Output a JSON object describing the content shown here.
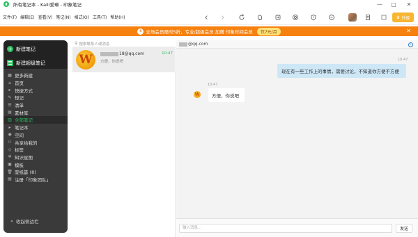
{
  "titlebar": {
    "title": "所有笔记本 - Kaili爱琳 - 印象笔记",
    "min": "—",
    "max": "▢",
    "close": "✕"
  },
  "menu": [
    "文件(F)",
    "编辑(E)",
    "查看(V)",
    "笔记(N)",
    "格式(O)",
    "工具(T)",
    "帮助(H)"
  ],
  "toolbar": {
    "back": "‹",
    "forward": "›",
    "upgrade_label": "升级"
  },
  "banner": {
    "text": "全场会员限时5折，专业/超级会员 加赠 印象时间会员",
    "pill": "仅7元/月",
    "close": "✕"
  },
  "sidebar": {
    "new_note": "新建笔记",
    "new_super_note": "新建超级笔记",
    "items": [
      {
        "label": "更多新建",
        "icon": "▦",
        "active": false
      },
      {
        "label": "首页",
        "icon": "⌂",
        "active": false
      },
      {
        "label": "快捷方式",
        "icon": "▸",
        "active": false
      },
      {
        "label": "轻记",
        "icon": "✎",
        "active": false
      },
      {
        "label": "清单",
        "icon": "☰",
        "active": false
      },
      {
        "label": "素材库",
        "icon": "▤",
        "active": false
      },
      {
        "label": "全部笔记",
        "icon": "▥",
        "active": true
      },
      {
        "label": "笔记本",
        "icon": "▸",
        "active": false
      },
      {
        "label": "空间",
        "icon": "◉",
        "active": false
      },
      {
        "label": "共享给我的",
        "icon": "⚇",
        "active": false
      },
      {
        "label": "标签",
        "icon": "◇",
        "active": false
      },
      {
        "label": "知识星图",
        "icon": "✲",
        "active": false
      },
      {
        "label": "模板",
        "icon": "▣",
        "active": false
      },
      {
        "label": "废纸篓 (8)",
        "icon": "🗑",
        "active": false
      },
      {
        "label": "注册「印象团队」",
        "icon": "▤",
        "active": false
      }
    ],
    "collapse": "收起侧边栏"
  },
  "list": {
    "search_placeholder": "搜索联系人或消息",
    "conversation": {
      "name_suffix": "18@qq.com",
      "time": "10:47",
      "preview": "方便，你说吧"
    }
  },
  "chat": {
    "header_suffix": "@qq.com",
    "messages": [
      {
        "side": "right",
        "time": "10:47",
        "text": "现在有一些工作上的事情，需要讨论，不知道你方便不方便"
      },
      {
        "side": "left",
        "time": "10:47",
        "text": "方便，你说吧"
      }
    ],
    "input_placeholder": "输入消息...",
    "send_label": "发送"
  },
  "colors": {
    "accent": "#2dbe60",
    "banner": "#f7810f",
    "upgrade": "#f7b531",
    "bubble": "#cde7f7"
  }
}
